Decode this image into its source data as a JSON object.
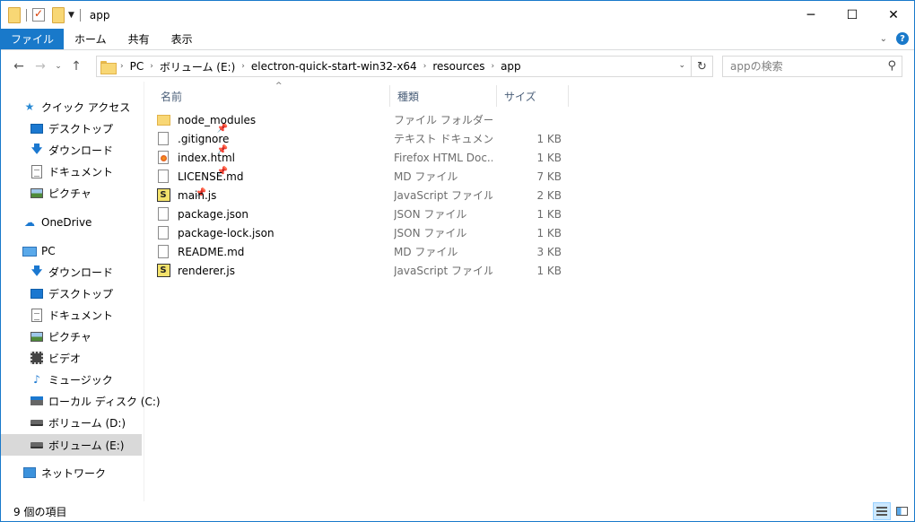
{
  "window": {
    "title": "app",
    "controls": {
      "minimize": "─",
      "maximize": "☐",
      "close": "✕"
    }
  },
  "ribbon": {
    "tabs": [
      "ファイル",
      "ホーム",
      "共有",
      "表示"
    ]
  },
  "address": {
    "crumbs": [
      "PC",
      "ボリューム (E:)",
      "electron-quick-start-win32-x64",
      "resources",
      "app"
    ]
  },
  "search": {
    "placeholder": "appの検索"
  },
  "nav": {
    "quick_access": "クイック アクセス",
    "quick_items": [
      "デスクトップ",
      "ダウンロード",
      "ドキュメント",
      "ピクチャ"
    ],
    "onedrive": "OneDrive",
    "pc": "PC",
    "pc_items": [
      "ダウンロード",
      "デスクトップ",
      "ドキュメント",
      "ピクチャ",
      "ビデオ",
      "ミュージック",
      "ローカル ディスク (C:)",
      "ボリューム (D:)",
      "ボリューム (E:)"
    ],
    "network": "ネットワーク"
  },
  "columns": {
    "name": "名前",
    "type": "種類",
    "size": "サイズ"
  },
  "files": [
    {
      "name": "node_modules",
      "type": "ファイル フォルダー",
      "size": "",
      "icon": "folder-icon"
    },
    {
      "name": ".gitignore",
      "type": "テキスト ドキュメント",
      "size": "1 KB",
      "icon": "text-file-icon"
    },
    {
      "name": "index.html",
      "type": "Firefox HTML Doc...",
      "size": "1 KB",
      "icon": "firefox-html-icon"
    },
    {
      "name": "LICENSE.md",
      "type": "MD ファイル",
      "size": "7 KB",
      "icon": "file-icon"
    },
    {
      "name": "main.js",
      "type": "JavaScript ファイル",
      "size": "2 KB",
      "icon": "js-file-icon"
    },
    {
      "name": "package.json",
      "type": "JSON ファイル",
      "size": "1 KB",
      "icon": "file-icon"
    },
    {
      "name": "package-lock.json",
      "type": "JSON ファイル",
      "size": "1 KB",
      "icon": "file-icon"
    },
    {
      "name": "README.md",
      "type": "MD ファイル",
      "size": "3 KB",
      "icon": "file-icon"
    },
    {
      "name": "renderer.js",
      "type": "JavaScript ファイル",
      "size": "1 KB",
      "icon": "js-file-icon"
    }
  ],
  "status": {
    "item_count": "9 個の項目"
  },
  "colors": {
    "accent": "#1979ca",
    "selected_nav": "#d9d9d9",
    "secondary_text": "#6d6d6d"
  }
}
